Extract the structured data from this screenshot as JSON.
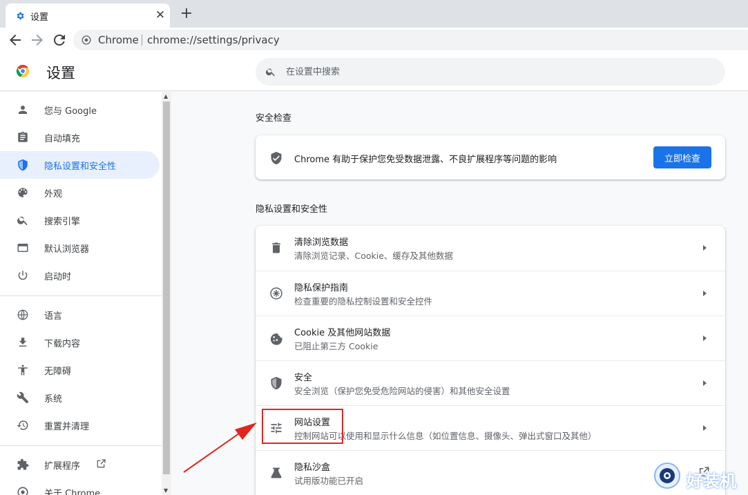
{
  "tab": {
    "title": "设置",
    "close": "✕",
    "new_tab": "+"
  },
  "omnibox": {
    "label": "Chrome",
    "url": "chrome://settings/privacy"
  },
  "header": {
    "title": "设置",
    "search_placeholder": "在设置中搜索"
  },
  "sidebar": {
    "items": [
      {
        "label": "您与 Google",
        "icon": "person-icon"
      },
      {
        "label": "自动填充",
        "icon": "clipboard-icon"
      },
      {
        "label": "隐私设置和安全性",
        "icon": "shield-icon",
        "active": true
      },
      {
        "label": "外观",
        "icon": "palette-icon"
      },
      {
        "label": "搜索引擎",
        "icon": "search-icon"
      },
      {
        "label": "默认浏览器",
        "icon": "browser-window-icon"
      },
      {
        "label": "启动时",
        "icon": "power-icon"
      },
      {
        "label": "语言",
        "icon": "globe-icon"
      },
      {
        "label": "下载内容",
        "icon": "download-icon"
      },
      {
        "label": "无障碍",
        "icon": "accessibility-icon"
      },
      {
        "label": "系统",
        "icon": "wrench-icon"
      },
      {
        "label": "重置并清理",
        "icon": "history-icon"
      },
      {
        "label": "扩展程序",
        "icon": "puzzle-icon"
      },
      {
        "label": "关于 Chrome",
        "icon": "chrome-icon"
      }
    ]
  },
  "safety_check": {
    "section_title": "安全检查",
    "text": "Chrome 有助于保护您免受数据泄露、不良扩展程序等问题的影响",
    "button": "立即检查"
  },
  "privacy": {
    "section_title": "隐私设置和安全性",
    "rows": [
      {
        "title": "清除浏览数据",
        "subtitle": "清除浏览记录、Cookie、缓存及其他数据",
        "icon": "trash-icon"
      },
      {
        "title": "隐私保护指南",
        "subtitle": "检查重要的隐私控制设置和安全控件",
        "icon": "compass-icon"
      },
      {
        "title": "Cookie 及其他网站数据",
        "subtitle": "已阻止第三方 Cookie",
        "icon": "cookie-icon"
      },
      {
        "title": "安全",
        "subtitle": "安全浏览（保护您免受危险网站的侵害）和其他安全设置",
        "icon": "security-shield-icon"
      },
      {
        "title": "网站设置",
        "subtitle": "控制网站可以使用和显示什么信息（如位置信息、摄像头、弹出式窗口及其他）",
        "icon": "tune-icon"
      },
      {
        "title": "隐私沙盒",
        "subtitle": "试用版功能已开启",
        "icon": "flask-icon"
      }
    ]
  },
  "watermark": {
    "text": "好装机"
  },
  "colors": {
    "accent": "#1a73e8",
    "active_bg": "#e8f0fe",
    "annotation": "#e0261f"
  }
}
